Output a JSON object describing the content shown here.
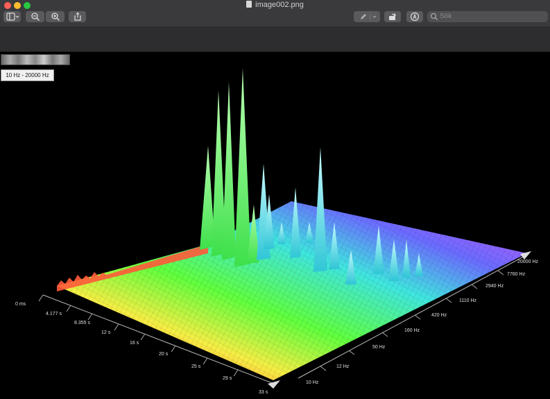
{
  "window": {
    "title": "image002.png"
  },
  "toolbar": {
    "sidebar_icon": "sidebar-icon",
    "zoom_out_icon": "zoom-out-icon",
    "zoom_in_icon": "zoom-in-icon",
    "share_icon": "share-icon",
    "markup_icon": "pen-icon",
    "rotate_icon": "rotate-icon",
    "annotate_icon": "annotate-icon",
    "search_placeholder": "Sök"
  },
  "viewer": {
    "frequency_range": "10 Hz - 20000 Hz",
    "time_axis_labels": [
      "0 ms",
      "4.177 s",
      "8.355 s",
      "12 s",
      "16 s",
      "20 s",
      "25 s",
      "29 s",
      "33 s"
    ],
    "freq_axis_labels": [
      "10 Hz",
      "12 Hz",
      "50 Hz",
      "160 Hz",
      "420 Hz",
      "1110 Hz",
      "2940 Hz",
      "7760 Hz",
      "20000 Hz"
    ]
  },
  "colors": {
    "low": "#ff3030",
    "mid": "#4cff3c",
    "high": "#d550ff",
    "background": "#000000"
  }
}
